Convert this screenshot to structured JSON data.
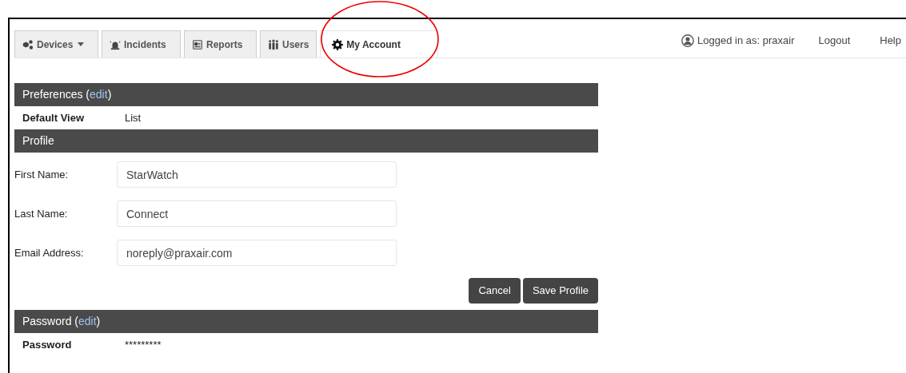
{
  "tabs": [
    {
      "label": "Devices",
      "dropdown": true,
      "selected": false
    },
    {
      "label": "Incidents",
      "dropdown": false,
      "selected": false
    },
    {
      "label": "Reports",
      "dropdown": false,
      "selected": false
    },
    {
      "label": "Users",
      "dropdown": false,
      "selected": false
    },
    {
      "label": "My Account",
      "dropdown": false,
      "selected": true
    }
  ],
  "user_nav": {
    "logged_in": "Logged in as: praxair",
    "links": [
      "Logout",
      "Help"
    ]
  },
  "preferences": {
    "header": {
      "before": "Preferences (",
      "link": "edit",
      "after": ")"
    },
    "rows": [
      {
        "label": "Default View",
        "value": "List"
      }
    ]
  },
  "profile": {
    "header": {
      "before": "Profile"
    },
    "fields": [
      {
        "label": "First Name:",
        "value": "StarWatch"
      },
      {
        "label": "Last Name:",
        "value": "Connect"
      },
      {
        "label": "Email Address:",
        "value": "noreply@praxair.com"
      }
    ],
    "buttons": [
      "Cancel",
      "Save Profile"
    ]
  },
  "password": {
    "header": {
      "before": "Password (",
      "link": "edit",
      "after": ")"
    },
    "rows": [
      {
        "label": "Password",
        "value": "*********"
      }
    ]
  }
}
